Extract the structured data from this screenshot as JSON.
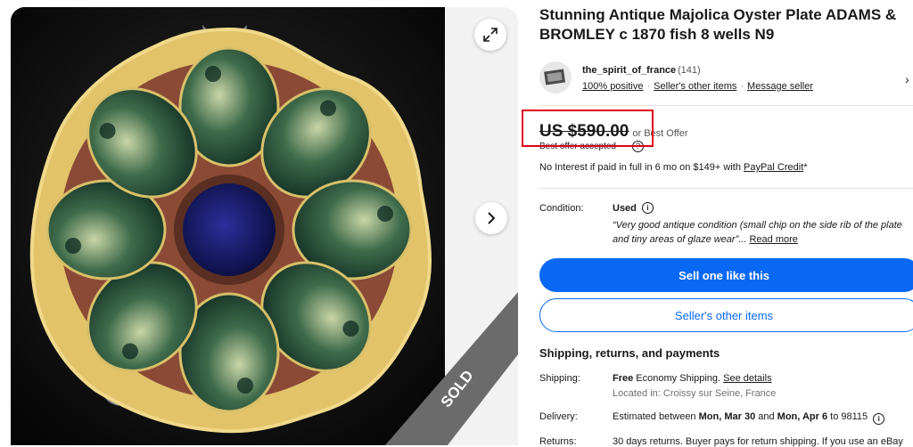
{
  "gallery": {
    "sold_label": "SOLD",
    "expand_icon": "expand-icon",
    "next_icon": "chevron-right-icon"
  },
  "listing": {
    "title": "Stunning Antique Majolica Oyster Plate ADAMS & BROMLEY c 1870 fish 8 wells N9"
  },
  "seller": {
    "name": "the_spirit_of_france",
    "feedback_count": "(141)",
    "positive": "100% positive",
    "other_items": "Seller's other items",
    "message": "Message seller",
    "separator": "·"
  },
  "price": {
    "amount": "US $590.00",
    "or_best_offer": "or Best Offer",
    "best_offer_accepted": "Best offer accepted",
    "financing_prefix": "No Interest if paid in full in 6 mo on $149+ with ",
    "financing_link": "PayPal Credit",
    "financing_suffix": "*"
  },
  "condition": {
    "label": "Condition:",
    "value": "Used",
    "quote": "“Very good antique condition (small chip on the side rib of the plate and tiny areas of glaze wear”...",
    "read_more": "Read more"
  },
  "buttons": {
    "sell_one": "Sell one like this",
    "sellers_other_items": "Seller's other items"
  },
  "shipping": {
    "heading": "Shipping, returns, and payments",
    "shipping_label": "Shipping:",
    "shipping_free": "Free",
    "shipping_method": " Economy Shipping. ",
    "see_details": "See details",
    "located": "Located in: Croissy sur Seine, France",
    "delivery_label": "Delivery:",
    "delivery_prefix": "Estimated between ",
    "delivery_start": "Mon, Mar 30",
    "delivery_and": " and ",
    "delivery_end": "Mon, Apr 6",
    "delivery_to": " to 98115",
    "returns_label": "Returns:",
    "returns_text": "30 days returns. Buyer pays for return shipping. If you use an eBay"
  },
  "colors": {
    "accent_blue": "#0968f6",
    "highlight_red": "#e0001b",
    "sold_band": "#6b6b6b"
  }
}
